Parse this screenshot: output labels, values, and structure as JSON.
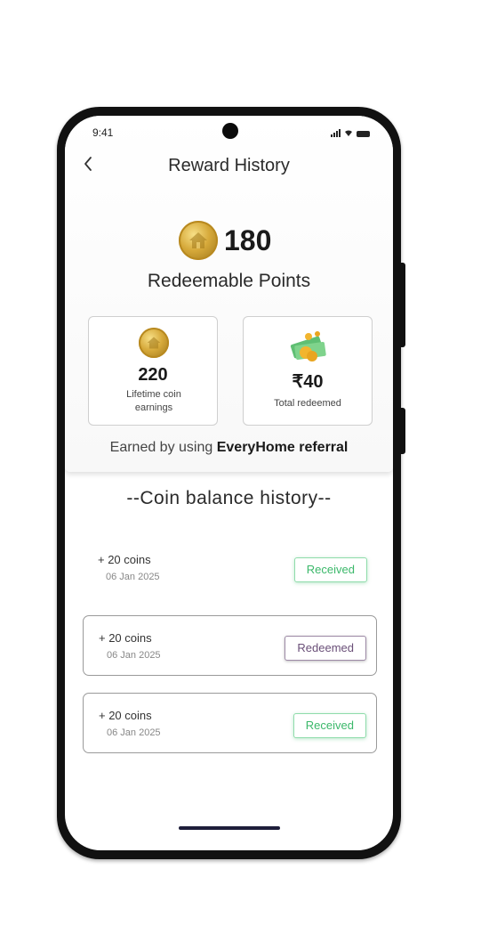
{
  "status_bar": {
    "time": "9:41"
  },
  "header": {
    "title": "Reward History",
    "back_icon": "chevron-left-icon",
    "points_value": "180",
    "points_label": "Redeemable Points",
    "coin_icon": "gold-coin-home-icon"
  },
  "stats": {
    "lifetime": {
      "value": "220",
      "label": "Lifetime coin earnings",
      "icon": "gold-coin-home-icon"
    },
    "redeemed": {
      "value": "₹40",
      "label": "Total redeemed",
      "icon": "cash-coins-icon"
    }
  },
  "referral": {
    "prefix": "Earned by using ",
    "brand": "EveryHome referral"
  },
  "history": {
    "title": "--Coin balance history--",
    "items": [
      {
        "amount": "+ 20 coins",
        "date": "06 Jan 2025",
        "status": "Received"
      },
      {
        "amount": "+ 20 coins",
        "date": "06 Jan 2025",
        "status": "Redeemed"
      },
      {
        "amount": "+ 20 coins",
        "date": "06 Jan 2025",
        "status": "Received"
      }
    ]
  },
  "colors": {
    "received": "#3bb86a",
    "redeemed": "#6a4f78",
    "coin_gold": "#d6a93a"
  }
}
